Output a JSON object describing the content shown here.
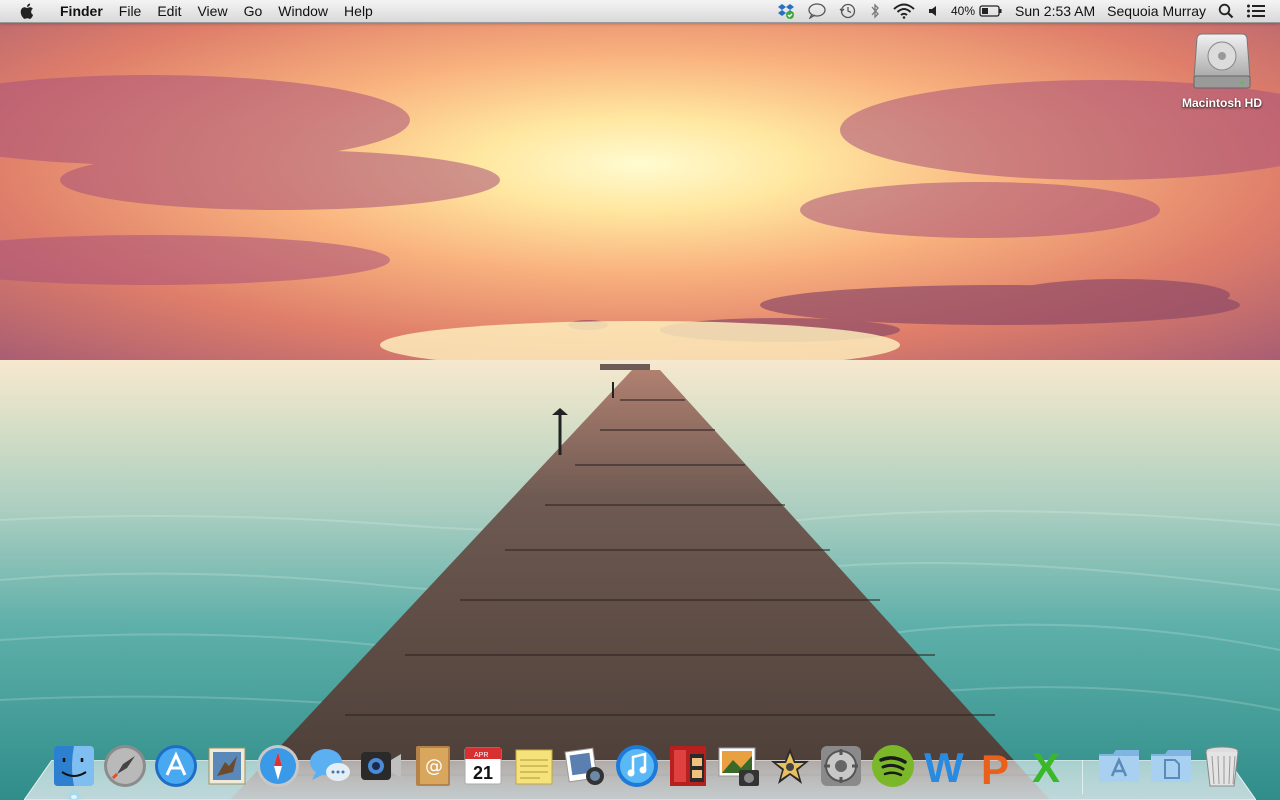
{
  "menubar": {
    "apple_icon": "apple-logo-icon",
    "app_name": "Finder",
    "menus": [
      "File",
      "Edit",
      "View",
      "Go",
      "Window",
      "Help"
    ],
    "status": {
      "icons": [
        "dropbox-icon",
        "messages-status-icon",
        "time-machine-icon",
        "bluetooth-icon",
        "wifi-icon",
        "volume-icon"
      ],
      "battery_percent": "40%",
      "battery_icon": "battery-icon",
      "clock": "Sun 2:53 AM",
      "user": "Sequoia Murray",
      "spotlight_icon": "spotlight-search-icon",
      "notifications_icon": "notification-center-icon"
    }
  },
  "desktop": {
    "wallpaper": "sunset-ocean-pier",
    "icons": [
      {
        "label": "Macintosh HD",
        "icon": "hard-drive-icon"
      }
    ]
  },
  "dock": {
    "apps": [
      {
        "name": "Finder",
        "icon": "finder-icon",
        "running": true
      },
      {
        "name": "Launchpad",
        "icon": "launchpad-icon"
      },
      {
        "name": "App Store",
        "icon": "app-store-icon"
      },
      {
        "name": "Mail",
        "icon": "mail-icon"
      },
      {
        "name": "Safari",
        "icon": "safari-icon"
      },
      {
        "name": "Messages",
        "icon": "messages-icon"
      },
      {
        "name": "FaceTime",
        "icon": "facetime-icon"
      },
      {
        "name": "Contacts",
        "icon": "contacts-icon"
      },
      {
        "name": "Calendar",
        "icon": "calendar-icon",
        "month": "APR",
        "day": "21"
      },
      {
        "name": "Notes",
        "icon": "notes-icon"
      },
      {
        "name": "Photo Booth",
        "icon": "photo-booth-icon"
      },
      {
        "name": "iTunes",
        "icon": "itunes-icon"
      },
      {
        "name": "Photo Booth Movie",
        "icon": "photo-booth-movie-icon"
      },
      {
        "name": "iPhoto",
        "icon": "iphoto-icon"
      },
      {
        "name": "iMovie",
        "icon": "imovie-icon"
      },
      {
        "name": "System Preferences",
        "icon": "system-preferences-icon"
      },
      {
        "name": "Spotify",
        "icon": "spotify-icon"
      },
      {
        "name": "Microsoft Word",
        "icon": "word-icon",
        "letter": "W"
      },
      {
        "name": "Microsoft PowerPoint",
        "icon": "powerpoint-icon",
        "letter": "P"
      },
      {
        "name": "Microsoft Excel",
        "icon": "excel-icon",
        "letter": "X"
      }
    ],
    "stacks": [
      {
        "name": "Applications",
        "icon": "applications-folder-icon"
      },
      {
        "name": "Documents",
        "icon": "documents-folder-icon"
      }
    ],
    "trash": {
      "name": "Trash",
      "icon": "trash-icon"
    }
  },
  "colors": {
    "menubar_bg": "#e4e4e4",
    "sky_top": "#7a4e8c",
    "sky_glow": "#fff6b8",
    "sea": "#3f9e9a",
    "pier": "#5a4a40"
  }
}
